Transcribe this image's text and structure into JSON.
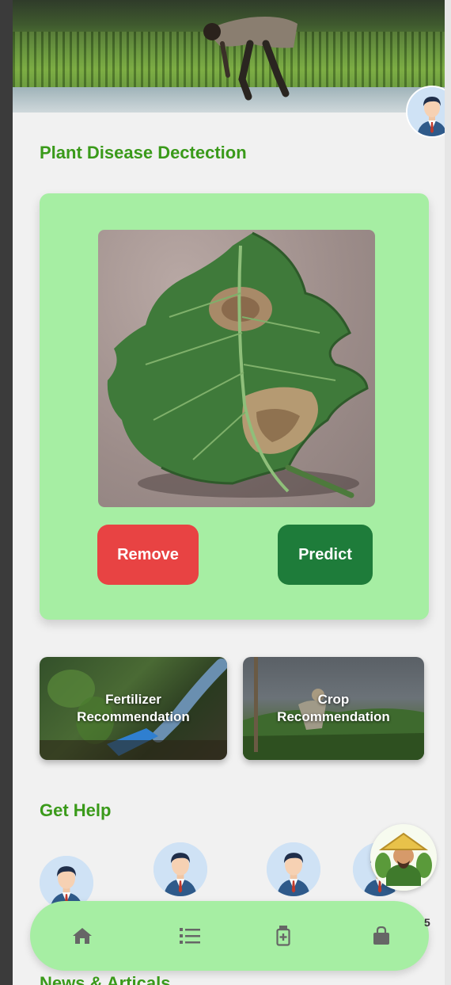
{
  "app": {
    "section_title": "Plant Disease Dectection"
  },
  "detect": {
    "remove_label": "Remove",
    "predict_label": "Predict"
  },
  "recommendations": [
    {
      "label": "Fertilizer\nRecommendation"
    },
    {
      "label": "Crop\nRecommendation"
    }
  ],
  "help": {
    "title": "Get Help"
  },
  "nav": {
    "items": [
      {
        "icon": "home-icon"
      },
      {
        "icon": "list-icon"
      },
      {
        "icon": "medicine-bottle-icon"
      },
      {
        "icon": "shopping-bag-icon"
      }
    ]
  },
  "news": {
    "title": "News & Articals"
  },
  "colors": {
    "accent_green": "#3a9a1a",
    "card_green": "#a6eea3",
    "remove_red": "#e84343",
    "predict_green": "#1e7c3a"
  }
}
